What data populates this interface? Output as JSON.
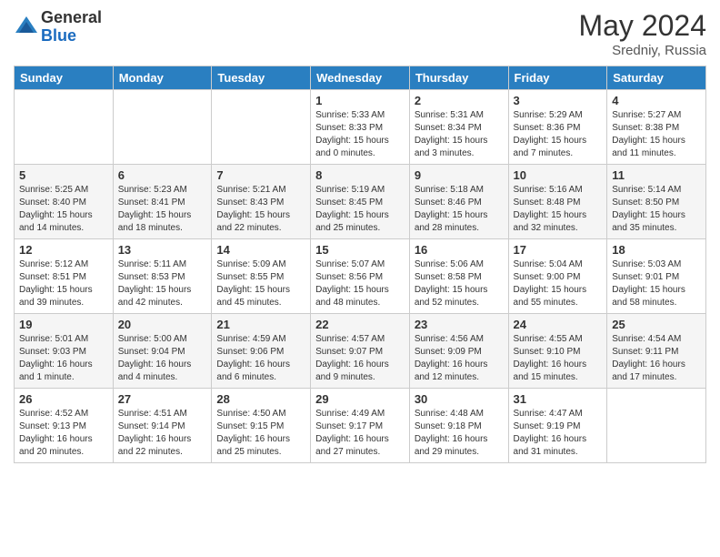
{
  "logo": {
    "general": "General",
    "blue": "Blue"
  },
  "title": {
    "month_year": "May 2024",
    "location": "Sredniy, Russia"
  },
  "weekdays": [
    "Sunday",
    "Monday",
    "Tuesday",
    "Wednesday",
    "Thursday",
    "Friday",
    "Saturday"
  ],
  "weeks": [
    [
      {
        "day": "",
        "info": ""
      },
      {
        "day": "",
        "info": ""
      },
      {
        "day": "",
        "info": ""
      },
      {
        "day": "1",
        "info": "Sunrise: 5:33 AM\nSunset: 8:33 PM\nDaylight: 15 hours\nand 0 minutes."
      },
      {
        "day": "2",
        "info": "Sunrise: 5:31 AM\nSunset: 8:34 PM\nDaylight: 15 hours\nand 3 minutes."
      },
      {
        "day": "3",
        "info": "Sunrise: 5:29 AM\nSunset: 8:36 PM\nDaylight: 15 hours\nand 7 minutes."
      },
      {
        "day": "4",
        "info": "Sunrise: 5:27 AM\nSunset: 8:38 PM\nDaylight: 15 hours\nand 11 minutes."
      }
    ],
    [
      {
        "day": "5",
        "info": "Sunrise: 5:25 AM\nSunset: 8:40 PM\nDaylight: 15 hours\nand 14 minutes."
      },
      {
        "day": "6",
        "info": "Sunrise: 5:23 AM\nSunset: 8:41 PM\nDaylight: 15 hours\nand 18 minutes."
      },
      {
        "day": "7",
        "info": "Sunrise: 5:21 AM\nSunset: 8:43 PM\nDaylight: 15 hours\nand 22 minutes."
      },
      {
        "day": "8",
        "info": "Sunrise: 5:19 AM\nSunset: 8:45 PM\nDaylight: 15 hours\nand 25 minutes."
      },
      {
        "day": "9",
        "info": "Sunrise: 5:18 AM\nSunset: 8:46 PM\nDaylight: 15 hours\nand 28 minutes."
      },
      {
        "day": "10",
        "info": "Sunrise: 5:16 AM\nSunset: 8:48 PM\nDaylight: 15 hours\nand 32 minutes."
      },
      {
        "day": "11",
        "info": "Sunrise: 5:14 AM\nSunset: 8:50 PM\nDaylight: 15 hours\nand 35 minutes."
      }
    ],
    [
      {
        "day": "12",
        "info": "Sunrise: 5:12 AM\nSunset: 8:51 PM\nDaylight: 15 hours\nand 39 minutes."
      },
      {
        "day": "13",
        "info": "Sunrise: 5:11 AM\nSunset: 8:53 PM\nDaylight: 15 hours\nand 42 minutes."
      },
      {
        "day": "14",
        "info": "Sunrise: 5:09 AM\nSunset: 8:55 PM\nDaylight: 15 hours\nand 45 minutes."
      },
      {
        "day": "15",
        "info": "Sunrise: 5:07 AM\nSunset: 8:56 PM\nDaylight: 15 hours\nand 48 minutes."
      },
      {
        "day": "16",
        "info": "Sunrise: 5:06 AM\nSunset: 8:58 PM\nDaylight: 15 hours\nand 52 minutes."
      },
      {
        "day": "17",
        "info": "Sunrise: 5:04 AM\nSunset: 9:00 PM\nDaylight: 15 hours\nand 55 minutes."
      },
      {
        "day": "18",
        "info": "Sunrise: 5:03 AM\nSunset: 9:01 PM\nDaylight: 15 hours\nand 58 minutes."
      }
    ],
    [
      {
        "day": "19",
        "info": "Sunrise: 5:01 AM\nSunset: 9:03 PM\nDaylight: 16 hours\nand 1 minute."
      },
      {
        "day": "20",
        "info": "Sunrise: 5:00 AM\nSunset: 9:04 PM\nDaylight: 16 hours\nand 4 minutes."
      },
      {
        "day": "21",
        "info": "Sunrise: 4:59 AM\nSunset: 9:06 PM\nDaylight: 16 hours\nand 6 minutes."
      },
      {
        "day": "22",
        "info": "Sunrise: 4:57 AM\nSunset: 9:07 PM\nDaylight: 16 hours\nand 9 minutes."
      },
      {
        "day": "23",
        "info": "Sunrise: 4:56 AM\nSunset: 9:09 PM\nDaylight: 16 hours\nand 12 minutes."
      },
      {
        "day": "24",
        "info": "Sunrise: 4:55 AM\nSunset: 9:10 PM\nDaylight: 16 hours\nand 15 minutes."
      },
      {
        "day": "25",
        "info": "Sunrise: 4:54 AM\nSunset: 9:11 PM\nDaylight: 16 hours\nand 17 minutes."
      }
    ],
    [
      {
        "day": "26",
        "info": "Sunrise: 4:52 AM\nSunset: 9:13 PM\nDaylight: 16 hours\nand 20 minutes."
      },
      {
        "day": "27",
        "info": "Sunrise: 4:51 AM\nSunset: 9:14 PM\nDaylight: 16 hours\nand 22 minutes."
      },
      {
        "day": "28",
        "info": "Sunrise: 4:50 AM\nSunset: 9:15 PM\nDaylight: 16 hours\nand 25 minutes."
      },
      {
        "day": "29",
        "info": "Sunrise: 4:49 AM\nSunset: 9:17 PM\nDaylight: 16 hours\nand 27 minutes."
      },
      {
        "day": "30",
        "info": "Sunrise: 4:48 AM\nSunset: 9:18 PM\nDaylight: 16 hours\nand 29 minutes."
      },
      {
        "day": "31",
        "info": "Sunrise: 4:47 AM\nSunset: 9:19 PM\nDaylight: 16 hours\nand 31 minutes."
      },
      {
        "day": "",
        "info": ""
      }
    ]
  ]
}
